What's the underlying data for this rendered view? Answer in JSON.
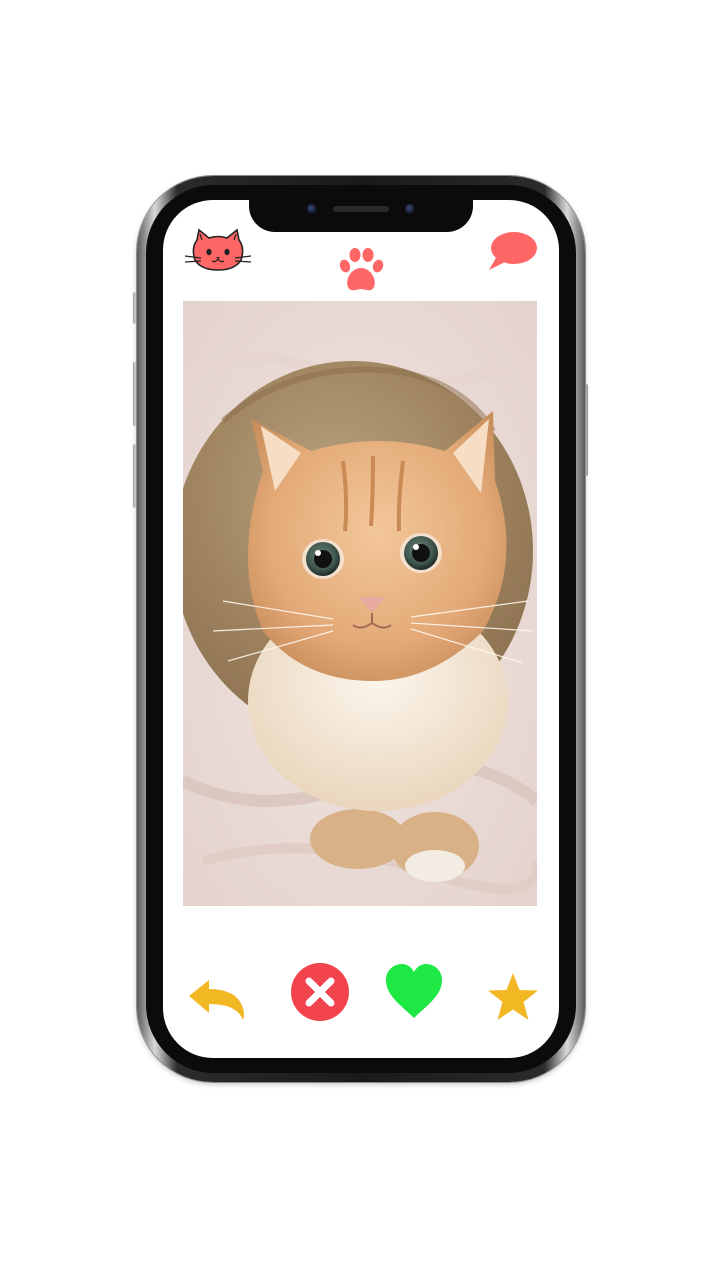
{
  "app": {
    "header": {
      "logo_icon": "cat-face-icon",
      "center_icon": "paw-icon",
      "chat_icon": "speech-bubble-icon"
    },
    "card": {
      "photo": "cat-photo"
    },
    "actions": {
      "undo_icon": "undo-arrow-icon",
      "dislike_icon": "close-circle-icon",
      "like_icon": "heart-icon",
      "superlike_icon": "star-icon"
    },
    "colors": {
      "brand": "#ff6666",
      "undo": "#f2b824",
      "dislike": "#f2424b",
      "like": "#1ee843",
      "star": "#f2b824"
    }
  }
}
